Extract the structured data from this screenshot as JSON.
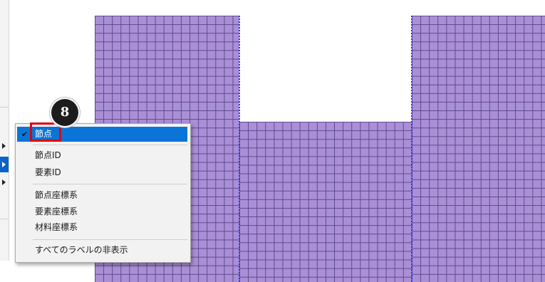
{
  "context_menu": {
    "items": [
      {
        "label": "節点",
        "checked": true,
        "selected": true
      },
      {
        "label": "節点ID"
      },
      {
        "label": "要素ID"
      },
      {
        "label": "節点座標系"
      },
      {
        "label": "要素座標系"
      },
      {
        "label": "材料座標系"
      },
      {
        "label": "すべてのラベルの非表示"
      }
    ],
    "check_glyph": "✔"
  },
  "callout": {
    "number": "8"
  },
  "colors": {
    "mesh_fill": "#ab8fd6",
    "mesh_lines": "#5a4a8a",
    "edge_dots": "#2d38d8",
    "selection": "#0a75d6",
    "highlight": "#e00012"
  }
}
